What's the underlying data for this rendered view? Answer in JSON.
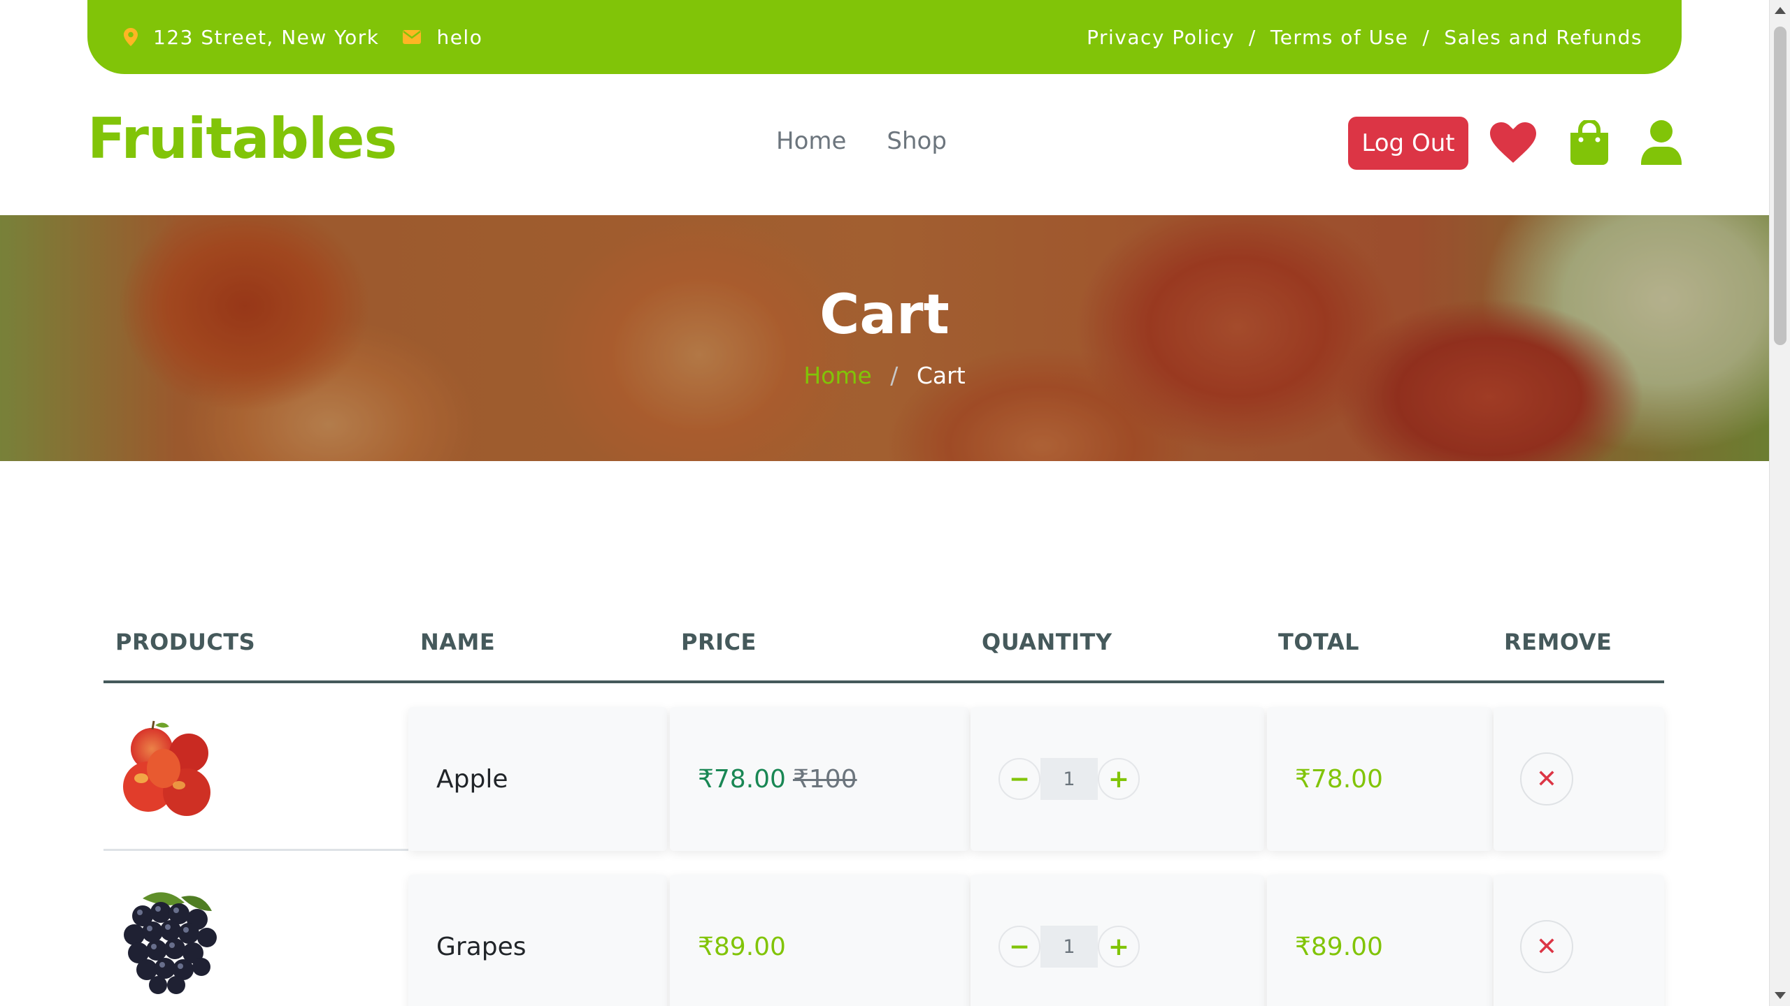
{
  "topbar": {
    "address": "123 Street, New York",
    "email": "helo",
    "links": [
      "Privacy Policy",
      "Terms of Use",
      "Sales and Refunds"
    ],
    "separator": "/",
    "icons": [
      "map-marker-icon",
      "envelope-icon"
    ]
  },
  "header": {
    "logo": "Fruitables",
    "nav": [
      "Home",
      "Shop"
    ],
    "logout_label": "Log Out",
    "icons": [
      "heart-icon",
      "shopping-bag-icon",
      "user-icon"
    ]
  },
  "hero": {
    "title": "Cart",
    "breadcrumb_home": "Home",
    "breadcrumb_separator": "/",
    "breadcrumb_current": "Cart"
  },
  "table": {
    "headers": [
      "PRODUCTS",
      "NAME",
      "PRICE",
      "QUANTITY",
      "TOTAL",
      "REMOVE"
    ],
    "rows": [
      {
        "name": "Apple",
        "price": "₹78.00",
        "old_price": "₹100",
        "quantity": "1",
        "total": "₹78.00",
        "image": "apple-image"
      },
      {
        "name": "Grapes",
        "price": "₹89.00",
        "old_price": "",
        "quantity": "1",
        "total": "₹89.00",
        "image": "grapes-image"
      }
    ],
    "qty_minus": "−",
    "qty_plus": "+",
    "remove_glyph": "✕"
  },
  "colors": {
    "brand": "#81c408",
    "danger": "#dc3545",
    "price_green": "#198754",
    "text": "#45595b"
  }
}
